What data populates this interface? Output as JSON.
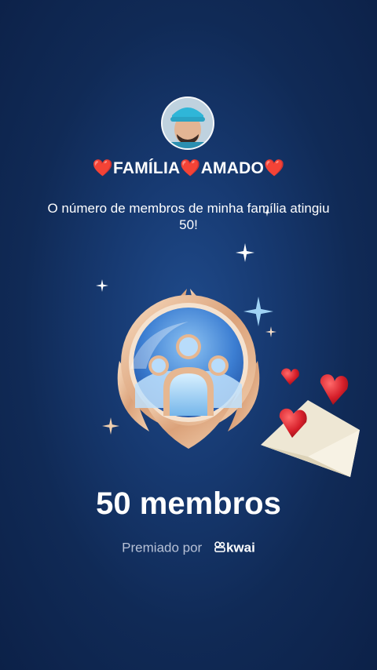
{
  "group": {
    "name": "❤️FAMÍLIA❤️AMADO❤️",
    "message": "O número de membros de minha família atingiu 50!"
  },
  "achievement": {
    "members_label": "50 membros"
  },
  "footer": {
    "awarded_by": "Premiado por",
    "brand": "kwai"
  },
  "icons": {
    "avatar": "profile-photo",
    "badge": "family-members-badge",
    "envelope": "love-letter-envelope",
    "hearts": "red-heart"
  },
  "colors": {
    "background": "#12305f",
    "badge_gold": "#e6b38a",
    "badge_blue": "#4d8fd8",
    "heart_red": "#d61f2a"
  }
}
